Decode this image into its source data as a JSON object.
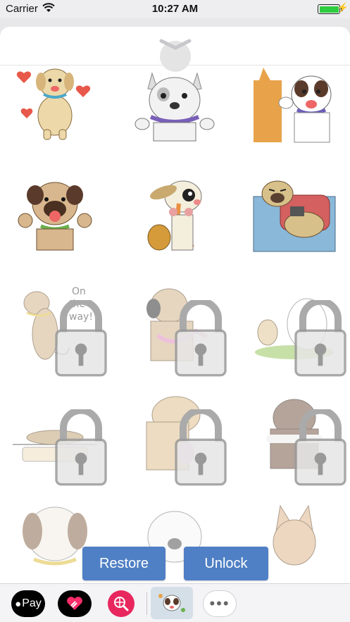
{
  "status": {
    "carrier": "Carrier",
    "time": "10:27 AM"
  },
  "stickers": [
    {
      "name": "happy-labrador-hearts",
      "locked": false
    },
    {
      "name": "french-bulldog-wave",
      "locked": false
    },
    {
      "name": "shiba-and-jack-russell",
      "locked": false
    },
    {
      "name": "pug-cheering",
      "locked": false
    },
    {
      "name": "chihuahua-with-bag",
      "locked": false
    },
    {
      "name": "pug-on-sofa",
      "locked": false
    },
    {
      "name": "dog-on-the-way",
      "locked": true,
      "text": "On the way!"
    },
    {
      "name": "pug-with-bib",
      "locked": true
    },
    {
      "name": "dogs-on-grass",
      "locked": true
    },
    {
      "name": "dog-on-table",
      "locked": true
    },
    {
      "name": "dog-with-toy",
      "locked": true
    },
    {
      "name": "dog-with-bone",
      "locked": true
    },
    {
      "name": "beagle",
      "locked": true
    },
    {
      "name": "bulldog",
      "locked": true
    },
    {
      "name": "corgi",
      "locked": true
    }
  ],
  "buttons": {
    "restore": "Restore",
    "unlock": "Unlock"
  },
  "dock": {
    "apple_pay": "Pay",
    "more": "•••"
  },
  "colors": {
    "accent": "#4f7fc4",
    "battery": "#2ecc40",
    "heart": "#e8275e"
  }
}
